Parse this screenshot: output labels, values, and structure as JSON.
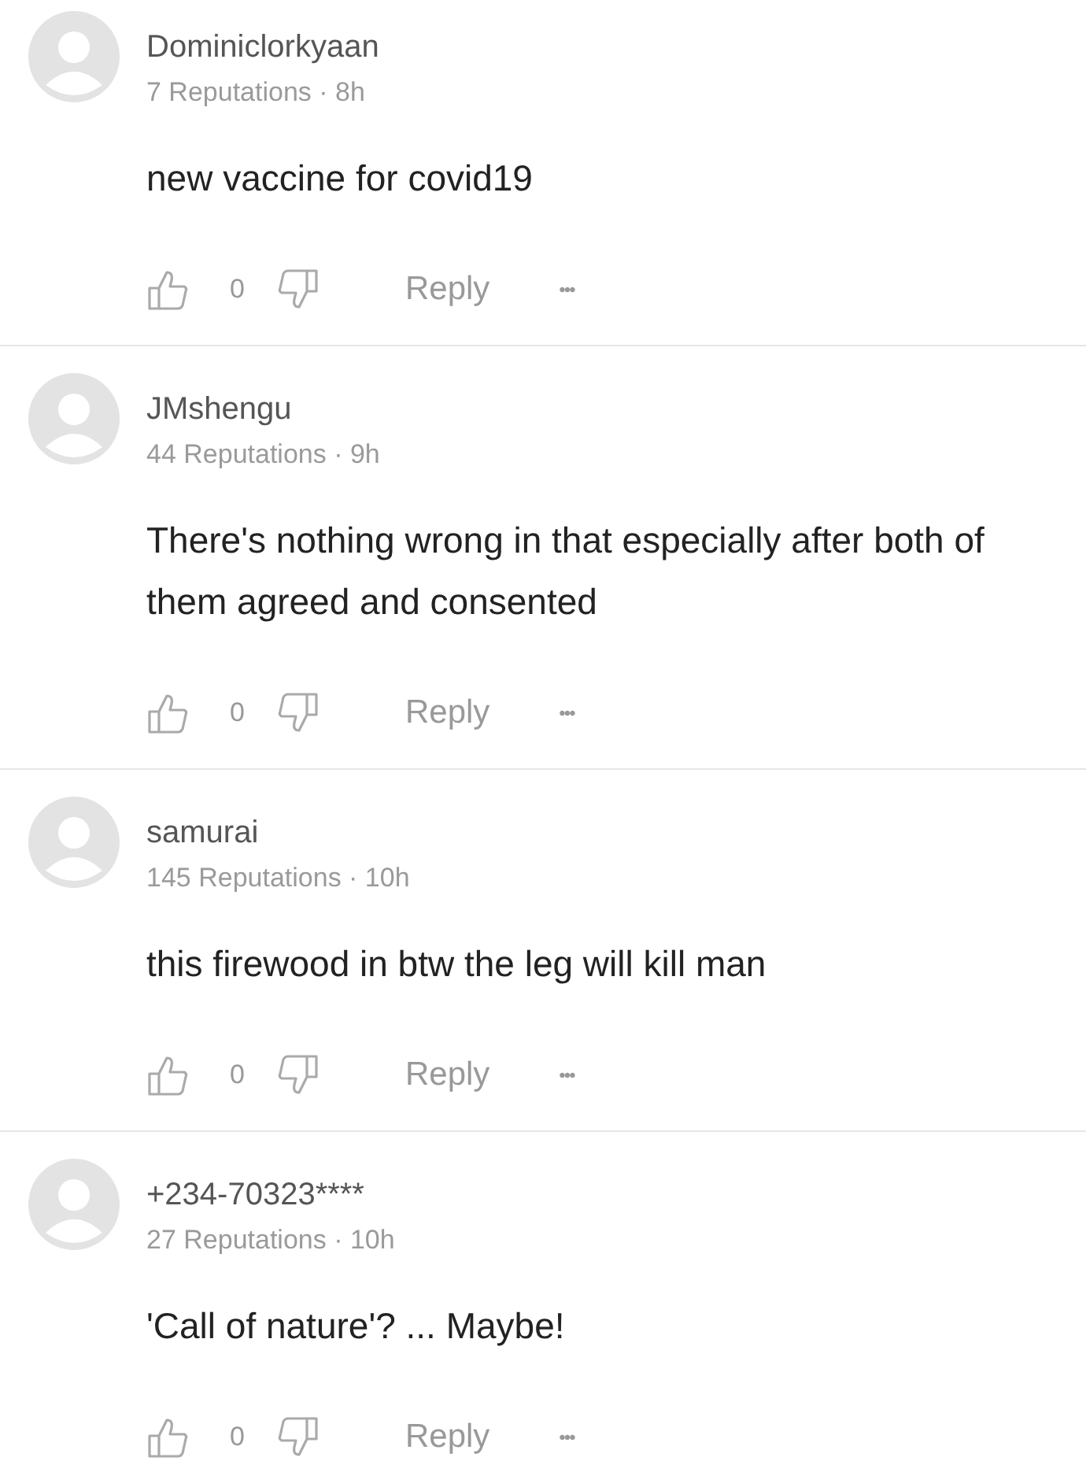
{
  "comments": [
    {
      "author": "Dominiclorkyaan",
      "meta": "7 Reputations · 8h",
      "text": "new vaccine for covid19",
      "likes": "0",
      "reply": "Reply",
      "more": "•••"
    },
    {
      "author": "JMshengu",
      "meta": "44 Reputations · 9h",
      "text": "There's nothing wrong in that especially after both of them agreed and consented",
      "likes": "0",
      "reply": "Reply",
      "more": "•••"
    },
    {
      "author": "samurai",
      "meta": "145 Reputations · 10h",
      "text": "this firewood in btw the leg will kill man",
      "likes": "0",
      "reply": "Reply",
      "more": "•••"
    },
    {
      "author": "+234-70323****",
      "meta": "27 Reputations · 10h",
      "text": "'Call of nature'? ... Maybe!",
      "likes": "0",
      "reply": "Reply",
      "more": "•••"
    }
  ]
}
